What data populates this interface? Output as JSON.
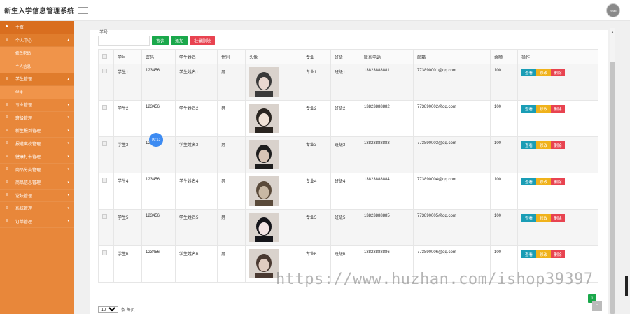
{
  "app": {
    "title": "新生入学信息管理系统",
    "avatar_text": "head"
  },
  "sidebar": {
    "items": [
      {
        "label": "主页",
        "icon": "flag-icon",
        "children": []
      },
      {
        "label": "个人中心",
        "icon": "menu-icon",
        "children": [
          "修改密码",
          "个人信息"
        ]
      },
      {
        "label": "学生管理",
        "icon": "menu-icon",
        "children": [
          "学生"
        ]
      },
      {
        "label": "专业管理",
        "icon": "menu-icon",
        "children": []
      },
      {
        "label": "班级管理",
        "icon": "menu-icon",
        "children": []
      },
      {
        "label": "新生报到管理",
        "icon": "menu-icon",
        "children": []
      },
      {
        "label": "报道离校管理",
        "icon": "menu-icon",
        "children": []
      },
      {
        "label": "健康打卡管理",
        "icon": "menu-icon",
        "children": []
      },
      {
        "label": "商品分类管理",
        "icon": "menu-icon",
        "children": []
      },
      {
        "label": "商品信息管理",
        "icon": "menu-icon",
        "children": []
      },
      {
        "label": "论坛管理",
        "icon": "menu-icon",
        "children": []
      },
      {
        "label": "系统管理",
        "icon": "menu-icon",
        "children": []
      },
      {
        "label": "订单管理",
        "icon": "menu-icon",
        "children": []
      }
    ]
  },
  "toolbar": {
    "search_label": "学号",
    "search_value": "",
    "search_btn": "查询",
    "add_btn": "添加",
    "batch_delete_btn": "批量删除"
  },
  "table": {
    "columns": [
      "学号",
      "密码",
      "学生姓名",
      "性别",
      "头像",
      "专业",
      "班级",
      "联系电话",
      "邮箱",
      "余额",
      "操作"
    ],
    "rows": [
      [
        "学生1",
        "123456",
        "学生姓名1",
        "男",
        "",
        "专业1",
        "班级1",
        "13823888881",
        "773890001@qq.com",
        "100"
      ],
      [
        "学生2",
        "123456",
        "学生姓名2",
        "男",
        "",
        "专业2",
        "班级2",
        "13823888882",
        "773890002@qq.com",
        "100"
      ],
      [
        "学生3",
        "123456",
        "学生姓名3",
        "男",
        "",
        "专业3",
        "班级3",
        "13823888883",
        "773890003@qq.com",
        "100"
      ],
      [
        "学生4",
        "123456",
        "学生姓名4",
        "男",
        "",
        "专业4",
        "班级4",
        "13823888884",
        "773890004@qq.com",
        "100"
      ],
      [
        "学生5",
        "123456",
        "学生姓名5",
        "男",
        "",
        "专业5",
        "班级5",
        "13823888885",
        "773890005@qq.com",
        "100"
      ],
      [
        "学生6",
        "123456",
        "学生姓名6",
        "男",
        "",
        "专业6",
        "班级6",
        "13823888886",
        "773890006@qq.com",
        "100"
      ]
    ],
    "actions": {
      "view": "查看",
      "edit": "修改",
      "delete": "删除"
    }
  },
  "pager": {
    "page_size": "10",
    "per_page_text": "条 每页",
    "current_page": "1"
  },
  "timer_overlay": "00:13",
  "watermark": "https://www.huzhan.com/ishop39397",
  "colors": {
    "sidebar": "#e8873a",
    "primary_green": "#1aa84b",
    "danger": "#e84350",
    "info": "#1a9db5",
    "warning": "#f0b21b"
  }
}
